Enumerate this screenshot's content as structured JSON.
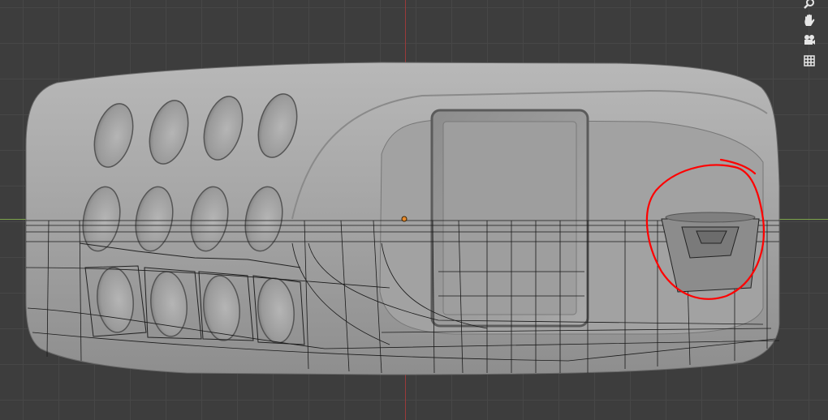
{
  "viewport": {
    "name": "3D Viewport",
    "mode": "edit-mode-mesh"
  },
  "colors": {
    "background": "#3d3d3d",
    "grid_line": "#474747",
    "x_axis": "#9a3b3b",
    "y_axis": "#7da24a",
    "mesh_fill": "#9b9b9b",
    "wireframe": "#111111",
    "annotation": "#ff0000",
    "origin": "#e88b2e"
  },
  "navigation": {
    "icons": [
      "zoom-icon",
      "hand-pan-icon",
      "camera-icon",
      "grid-perspective-icon"
    ]
  },
  "annotation": {
    "shape": "freehand-circle",
    "target": "speaker-cutout"
  }
}
